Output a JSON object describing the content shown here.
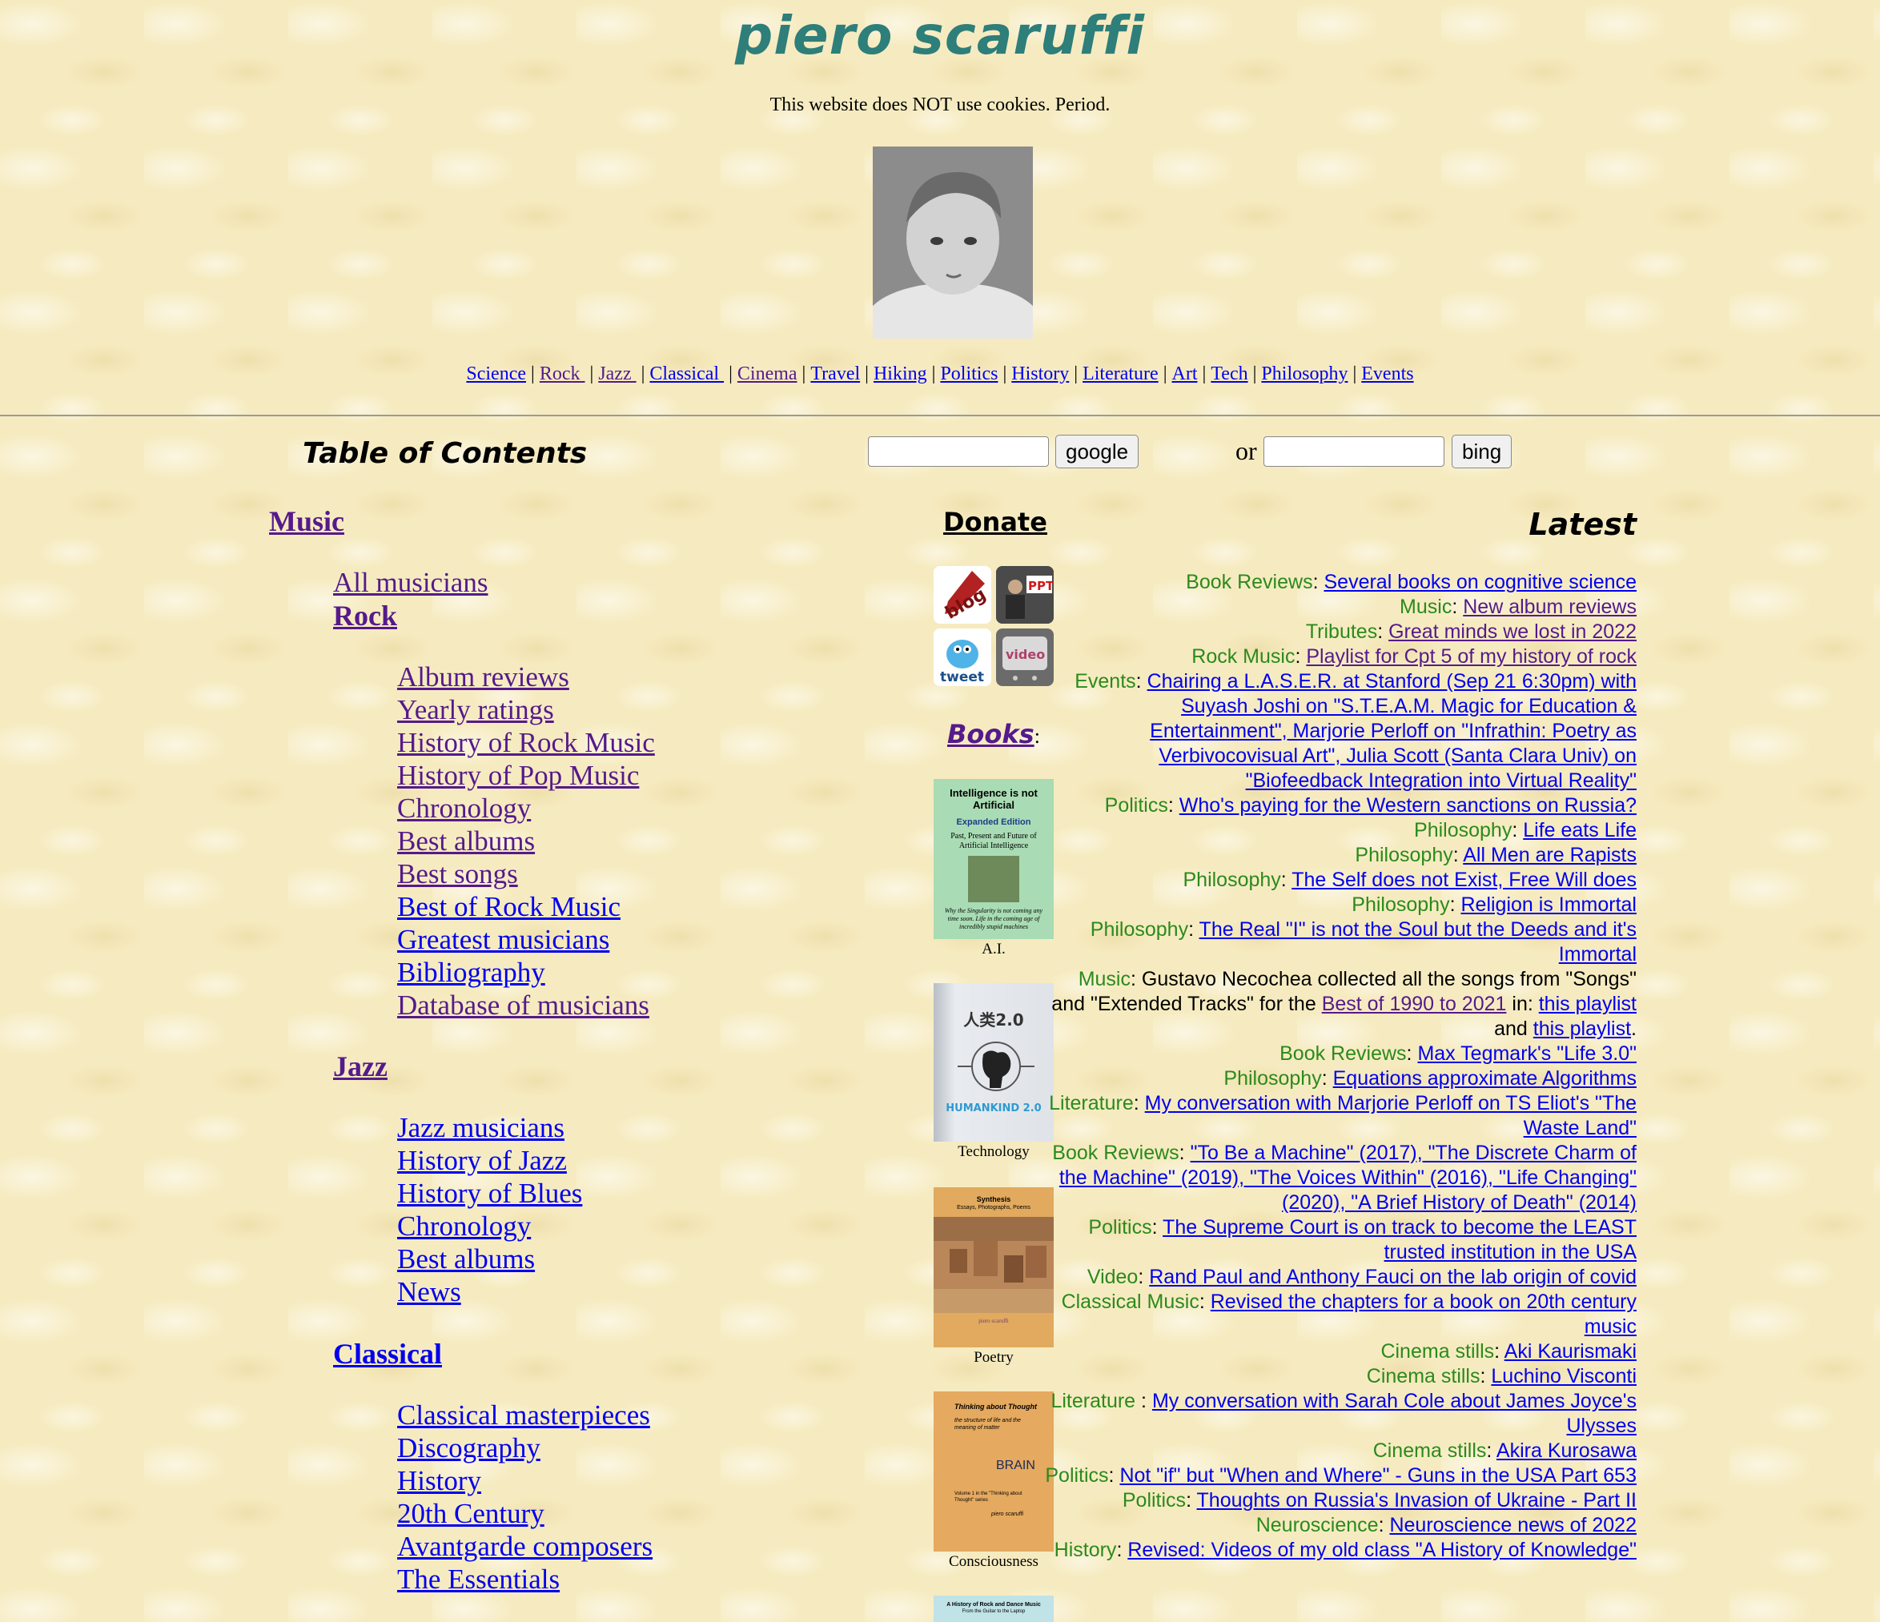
{
  "site": {
    "title": "piero scaruffi",
    "cookie_note": "This website does NOT use cookies. Period."
  },
  "nav": [
    {
      "label": "Science",
      "visited": false
    },
    {
      "label": "Rock ",
      "visited": true
    },
    {
      "label": "Jazz ",
      "visited": true
    },
    {
      "label": "Classical ",
      "visited": false
    },
    {
      "label": "Cinema",
      "visited": true
    },
    {
      "label": "Travel",
      "visited": false
    },
    {
      "label": "Hiking",
      "visited": false
    },
    {
      "label": "Politics",
      "visited": false
    },
    {
      "label": "History",
      "visited": false
    },
    {
      "label": "Literature",
      "visited": false
    },
    {
      "label": "Art",
      "visited": false
    },
    {
      "label": "Tech",
      "visited": false
    },
    {
      "label": "Philosophy",
      "visited": false
    },
    {
      "label": "Events",
      "visited": false
    }
  ],
  "nav_separator": "|",
  "toc": {
    "heading": "Table of Contents",
    "music_label": "Music",
    "all_musicians": "All musicians",
    "rock_label": "Rock",
    "rock_items": [
      {
        "label": "Album reviews",
        "visited": true
      },
      {
        "label": "Yearly ratings",
        "visited": true
      },
      {
        "label": "History of Rock Music",
        "visited": true
      },
      {
        "label": "History of Pop Music",
        "visited": true
      },
      {
        "label": "Chronology",
        "visited": true
      },
      {
        "label": "Best albums",
        "visited": true
      },
      {
        "label": "Best songs",
        "visited": true
      },
      {
        "label": "Best of Rock Music",
        "visited": false
      },
      {
        "label": "Greatest musicians",
        "visited": false
      },
      {
        "label": "Bibliography",
        "visited": false
      },
      {
        "label": "Database of musicians",
        "visited": true
      }
    ],
    "jazz_label": "Jazz",
    "jazz_items": [
      {
        "label": "Jazz musicians",
        "visited": false
      },
      {
        "label": "History of Jazz",
        "visited": false
      },
      {
        "label": "History of Blues",
        "visited": false
      },
      {
        "label": "Chronology",
        "visited": false
      },
      {
        "label": "Best albums",
        "visited": false
      },
      {
        "label": "News",
        "visited": false
      }
    ],
    "classical_label": "Classical",
    "classical_items": [
      {
        "label": "Classical masterpieces",
        "visited": false
      },
      {
        "label": "Discography",
        "visited": false
      },
      {
        "label": "History",
        "visited": false
      },
      {
        "label": "20th Century",
        "visited": false
      },
      {
        "label": "Avantgarde composers",
        "visited": false
      },
      {
        "label": "The Essentials",
        "visited": false
      }
    ]
  },
  "search": {
    "google_value": "",
    "google_button": "google",
    "or_label": "or",
    "bing_value": "",
    "bing_button": "bing"
  },
  "donate": {
    "heading": "Donate",
    "tiles": [
      {
        "label": "blog",
        "icon": "blog-icon"
      },
      {
        "label": "PPT",
        "icon": "ppt-icon"
      },
      {
        "label": "tweet",
        "icon": "tweet-icon"
      },
      {
        "label": "video",
        "icon": "video-icon"
      }
    ]
  },
  "books": {
    "heading": "Books",
    "colon": ":",
    "items": [
      {
        "caption": "A.I.",
        "cover_title": "Intelligence is not Artificial",
        "cover_subtitle": "Expanded Edition",
        "cover_line": "Past, Present and Future of Artificial Intelligence",
        "cover_blurb": "Why the Singularity is not coming any time soon. Life in the coming age of incredibly stupid machines",
        "color": "#a9dcb4"
      },
      {
        "caption": "Technology",
        "cover_title": "人类2.0",
        "cover_subtitle": "HUMANKIND 2.0",
        "color": "#d8dde3"
      },
      {
        "caption": "Poetry",
        "cover_title": "Synthesis",
        "cover_subtitle": "Essays, Photographs, Poems",
        "cover_author": "piero scaruffi",
        "color": "#e1aa5e"
      },
      {
        "caption": "Consciousness",
        "cover_title": "Thinking about Thought",
        "cover_subtitle": "the structure of life and the meaning of matter",
        "cover_big": "BRAIN",
        "cover_volume": "Volume 1 in the \"Thinking about Thought\" series",
        "cover_author": "piero scaruffi",
        "color": "#e5a95f"
      },
      {
        "caption": "",
        "cover_title": "A History of Rock and Dance Music",
        "cover_subtitle": "From the Guitar to the Laptop",
        "color": "#bfe3e6"
      }
    ]
  },
  "latest": {
    "heading": "Latest",
    "entries": [
      {
        "label": "Book Reviews",
        "sep": ": ",
        "parts": [
          {
            "t": "Several books on cognitive science",
            "link": true,
            "visited": false
          }
        ]
      },
      {
        "label": "Music",
        "sep": ": ",
        "parts": [
          {
            "t": "New album reviews",
            "link": true,
            "visited": true
          }
        ]
      },
      {
        "label": "Tributes",
        "sep": ": ",
        "parts": [
          {
            "t": "Great minds we lost in 2022",
            "link": true,
            "visited": true
          }
        ]
      },
      {
        "label": "Rock Music",
        "sep": ": ",
        "parts": [
          {
            "t": "Playlist for Cpt 5 of my history of rock",
            "link": true,
            "visited": true
          }
        ]
      },
      {
        "label": "Events",
        "sep": ": ",
        "parts": [
          {
            "t": "Chairing a L.A.S.E.R. at Stanford (Sep 21 6:30pm) with Suyash Joshi on \"S.T.E.A.M. Magic for Education & Entertainment\", Marjorie Perloff on \"Infrathin: Poetry as Verbivocovisual Art\", Julia Scott (Santa Clara Univ) on \"Biofeedback Integration into Virtual Reality\"",
            "link": true,
            "visited": false
          }
        ]
      },
      {
        "label": "Politics",
        "sep": ": ",
        "parts": [
          {
            "t": "Who's paying for the Western sanctions on Russia?",
            "link": true,
            "visited": false
          }
        ]
      },
      {
        "label": "Philosophy",
        "sep": ": ",
        "parts": [
          {
            "t": "Life eats Life",
            "link": true,
            "visited": false
          }
        ]
      },
      {
        "label": "Philosophy",
        "sep": ": ",
        "parts": [
          {
            "t": "All Men are Rapists",
            "link": true,
            "visited": false
          }
        ]
      },
      {
        "label": "Philosophy",
        "sep": ": ",
        "parts": [
          {
            "t": "The Self does not Exist, Free Will does",
            "link": true,
            "visited": false
          }
        ]
      },
      {
        "label": "Philosophy",
        "sep": ": ",
        "parts": [
          {
            "t": "Religion is Immortal",
            "link": true,
            "visited": false
          }
        ]
      },
      {
        "label": "Philosophy",
        "sep": ": ",
        "parts": [
          {
            "t": "The Real \"I\" is not the Soul but the Deeds and it's Immortal",
            "link": true,
            "visited": false
          }
        ]
      },
      {
        "label": "Music",
        "sep": ": ",
        "parts": [
          {
            "t": "Gustavo Necochea collected all the songs from \"Songs\" and \"Extended Tracks\" for the ",
            "link": false
          },
          {
            "t": "Best of 1990 to 2021",
            "link": true,
            "visited": true
          },
          {
            "t": " in: ",
            "link": false
          },
          {
            "t": "this playlist",
            "link": true,
            "visited": false
          },
          {
            "t": " and ",
            "link": false
          },
          {
            "t": "this playlist",
            "link": true,
            "visited": false
          },
          {
            "t": ".",
            "link": false
          }
        ]
      },
      {
        "label": "Book Reviews",
        "sep": ": ",
        "parts": [
          {
            "t": "Max Tegmark's \"Life 3.0\"",
            "link": true,
            "visited": false
          }
        ]
      },
      {
        "label": "Philosophy",
        "sep": ": ",
        "parts": [
          {
            "t": "Equations approximate Algorithms",
            "link": true,
            "visited": false
          }
        ]
      },
      {
        "label": "Literature",
        "sep": ": ",
        "parts": [
          {
            "t": "My conversation with Marjorie Perloff on TS Eliot's \"The Waste Land\"",
            "link": true,
            "visited": false
          }
        ]
      },
      {
        "label": "Book Reviews",
        "sep": ": ",
        "parts": [
          {
            "t": "\"To Be a Machine\" (2017), \"The Discrete Charm of the Machine\" (2019), \"The Voices Within\" (2016), \"Life Changing\" (2020), \"A Brief History of Death\" (2014)",
            "link": true,
            "visited": false
          }
        ]
      },
      {
        "label": "Politics",
        "sep": ": ",
        "parts": [
          {
            "t": "The Supreme Court is on track to become the LEAST trusted institution in the USA",
            "link": true,
            "visited": false
          }
        ]
      },
      {
        "label": "Video",
        "sep": ": ",
        "parts": [
          {
            "t": "Rand Paul and Anthony Fauci on the lab origin of covid",
            "link": true,
            "visited": false
          }
        ]
      },
      {
        "label": "Classical Music",
        "sep": ": ",
        "parts": [
          {
            "t": "Revised the chapters for a book on 20th century music",
            "link": true,
            "visited": false
          }
        ]
      },
      {
        "label": "Cinema stills",
        "sep": ": ",
        "parts": [
          {
            "t": "Aki Kaurismaki",
            "link": true,
            "visited": false
          }
        ]
      },
      {
        "label": "Cinema stills",
        "sep": ": ",
        "parts": [
          {
            "t": "Luchino Visconti",
            "link": true,
            "visited": false
          }
        ]
      },
      {
        "label": "Literature ",
        "sep": ": ",
        "parts": [
          {
            "t": "My conversation with Sarah Cole about James Joyce's Ulysses",
            "link": true,
            "visited": false
          }
        ]
      },
      {
        "label": "Cinema stills",
        "sep": ": ",
        "parts": [
          {
            "t": "Akira Kurosawa",
            "link": true,
            "visited": false
          }
        ]
      },
      {
        "label": "Politics",
        "sep": ": ",
        "parts": [
          {
            "t": "Not \"if\" but \"When and Where\" - Guns in the USA Part 653",
            "link": true,
            "visited": false
          }
        ]
      },
      {
        "label": "Politics",
        "sep": ": ",
        "parts": [
          {
            "t": "Thoughts on Russia's Invasion of Ukraine - Part II",
            "link": true,
            "visited": false
          }
        ]
      },
      {
        "label": "Neuroscience",
        "sep": ": ",
        "parts": [
          {
            "t": "Neuroscience news of 2022",
            "link": true,
            "visited": false
          }
        ]
      },
      {
        "label": "History",
        "sep": ": ",
        "parts": [
          {
            "t": "Revised: Videos of my old class \"A History of Knowledge\"",
            "link": true,
            "visited": false
          }
        ]
      }
    ]
  },
  "colors": {
    "link": "#0000ee",
    "visited": "#551a8b",
    "category": "#2b8a1c",
    "title": "#2e7e7a",
    "background": "#f6ebc0"
  }
}
